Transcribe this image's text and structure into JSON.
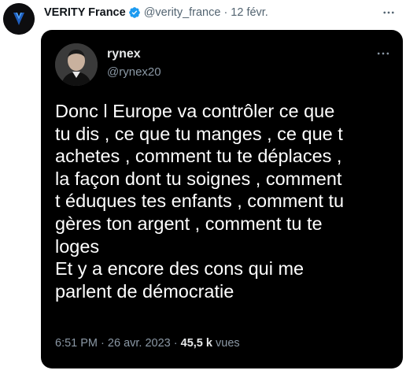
{
  "tweet": {
    "author_name": "VERITY France",
    "handle": "@verity_france",
    "separator": "·",
    "date": "12 févr.",
    "icons": {
      "avatar": "verity-logo-icon",
      "verified": "verified-badge-icon",
      "more": "more-options-icon"
    },
    "colors": {
      "verified": "#1d9bf0"
    }
  },
  "card": {
    "name": "rynex",
    "handle": "@rynex20",
    "text": "Donc l Europe va contrôler ce que\ntu dis , ce que tu manges , ce que t\nachetes , comment tu te déplaces ,\nla façon dont tu soignes , comment\nt éduques tes enfants , comment tu\ngères ton argent , comment tu te\nloges\nEt y a encore des cons qui me\nparlent de démocratie",
    "time": "6:51 PM",
    "separator1": "·",
    "date": "26 avr. 2023",
    "separator2": "·",
    "views_count": "45,5 k",
    "views_label": "vues",
    "icons": {
      "avatar": "user-avatar-icon",
      "more": "more-options-icon"
    },
    "colors": {
      "background": "#000000",
      "text": "#ffffff",
      "muted": "#8b98a5"
    }
  }
}
